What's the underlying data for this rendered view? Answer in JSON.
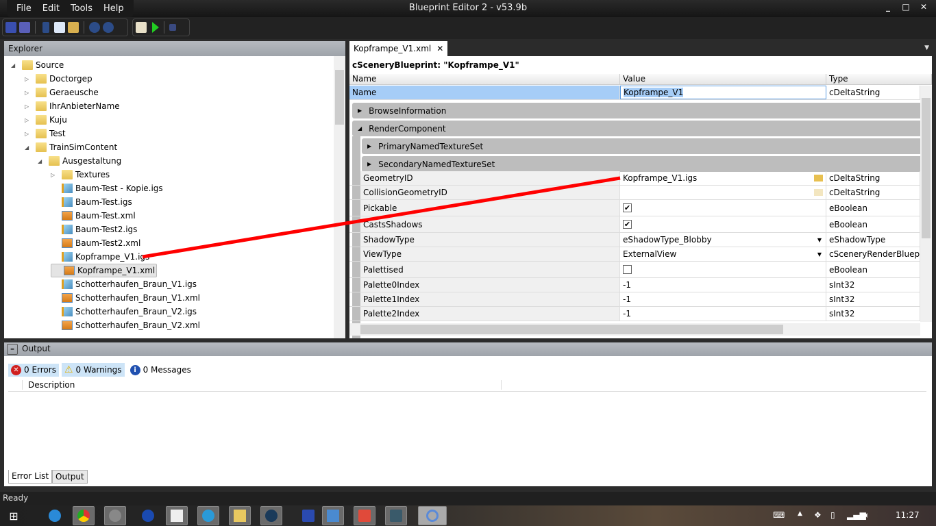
{
  "window": {
    "title": "Blueprint Editor 2 - v53.9b",
    "controls": [
      "_",
      "□",
      "✕"
    ]
  },
  "menu": [
    "File",
    "Edit",
    "Tools",
    "Help"
  ],
  "explorer": {
    "title": "Explorer",
    "tree": [
      {
        "label": "Source",
        "level": 0,
        "kind": "folder",
        "expanded": true
      },
      {
        "label": "Doctorgep",
        "level": 1,
        "kind": "folder",
        "expanded": false
      },
      {
        "label": "Geraeusche",
        "level": 1,
        "kind": "folder",
        "expanded": false
      },
      {
        "label": "IhrAnbieterName",
        "level": 1,
        "kind": "folder",
        "expanded": false
      },
      {
        "label": "Kuju",
        "level": 1,
        "kind": "folder",
        "expanded": false
      },
      {
        "label": "Test",
        "level": 1,
        "kind": "folder",
        "expanded": false
      },
      {
        "label": "TrainSimContent",
        "level": 1,
        "kind": "folder",
        "expanded": true
      },
      {
        "label": "Ausgestaltung",
        "level": 2,
        "kind": "folder",
        "expanded": true
      },
      {
        "label": "Textures",
        "level": 3,
        "kind": "folder",
        "expanded": false
      },
      {
        "label": "Baum-Test - Kopie.igs",
        "level": 3,
        "kind": "igs"
      },
      {
        "label": "Baum-Test.igs",
        "level": 3,
        "kind": "igs"
      },
      {
        "label": "Baum-Test.xml",
        "level": 3,
        "kind": "xml"
      },
      {
        "label": "Baum-Test2.igs",
        "level": 3,
        "kind": "igs"
      },
      {
        "label": "Baum-Test2.xml",
        "level": 3,
        "kind": "xml"
      },
      {
        "label": "Kopframpe_V1.igs",
        "level": 3,
        "kind": "igs"
      },
      {
        "label": "Kopframpe_V1.xml",
        "level": 3,
        "kind": "xml",
        "selected": true
      },
      {
        "label": "Schotterhaufen_Braun_V1.igs",
        "level": 3,
        "kind": "igs"
      },
      {
        "label": "Schotterhaufen_Braun_V1.xml",
        "level": 3,
        "kind": "xml"
      },
      {
        "label": "Schotterhaufen_Braun_V2.igs",
        "level": 3,
        "kind": "igs"
      },
      {
        "label": "Schotterhaufen_Braun_V2.xml",
        "level": 3,
        "kind": "xml"
      }
    ]
  },
  "editor": {
    "tab": "Kopframpe_V1.xml",
    "tab_close": "✕",
    "blueprint": "cSceneryBlueprint: \"Kopframpe_V1\"",
    "columns": [
      "Name",
      "Value",
      "Type"
    ],
    "name_row": {
      "name": "Name",
      "value": "Kopframpe_V1",
      "type": "cDeltaString"
    },
    "categories": [
      "BrowseInformation",
      "RenderComponent",
      "PrimaryNamedTextureSet",
      "SecondaryNamedTextureSet"
    ],
    "rows": [
      {
        "name": "GeometryID",
        "value": "Kopframpe_V1.igs",
        "type": "cDeltaString",
        "editor": "file"
      },
      {
        "name": "CollisionGeometryID",
        "value": "",
        "type": "cDeltaString",
        "editor": "file"
      },
      {
        "name": "Pickable",
        "value": "true",
        "type": "eBoolean",
        "editor": "check"
      },
      {
        "name": "CastsShadows",
        "value": "true",
        "type": "eBoolean",
        "editor": "check"
      },
      {
        "name": "ShadowType",
        "value": "eShadowType_Blobby",
        "type": "eShadowType",
        "editor": "combo"
      },
      {
        "name": "ViewType",
        "value": "ExternalView",
        "type": "cSceneryRenderBlueprint-",
        "editor": "combo"
      },
      {
        "name": "Palettised",
        "value": "false",
        "type": "eBoolean",
        "editor": "check"
      },
      {
        "name": "Palette0Index",
        "value": "-1",
        "type": "sInt32",
        "editor": "text"
      },
      {
        "name": "Palette1Index",
        "value": "-1",
        "type": "sInt32",
        "editor": "text"
      },
      {
        "name": "Palette2Index",
        "value": "-1",
        "type": "sInt32",
        "editor": "text"
      }
    ]
  },
  "output": {
    "title": "Output",
    "errors": "0 Errors",
    "warnings": "0 Warnings",
    "messages": "0 Messages",
    "column": "Description",
    "tabs": [
      "Error List",
      "Output"
    ]
  },
  "status": "Ready",
  "taskbar": {
    "clock": "11:27"
  },
  "colors": {
    "annotation": "#ff0000",
    "selection": "#a6cdf7"
  }
}
